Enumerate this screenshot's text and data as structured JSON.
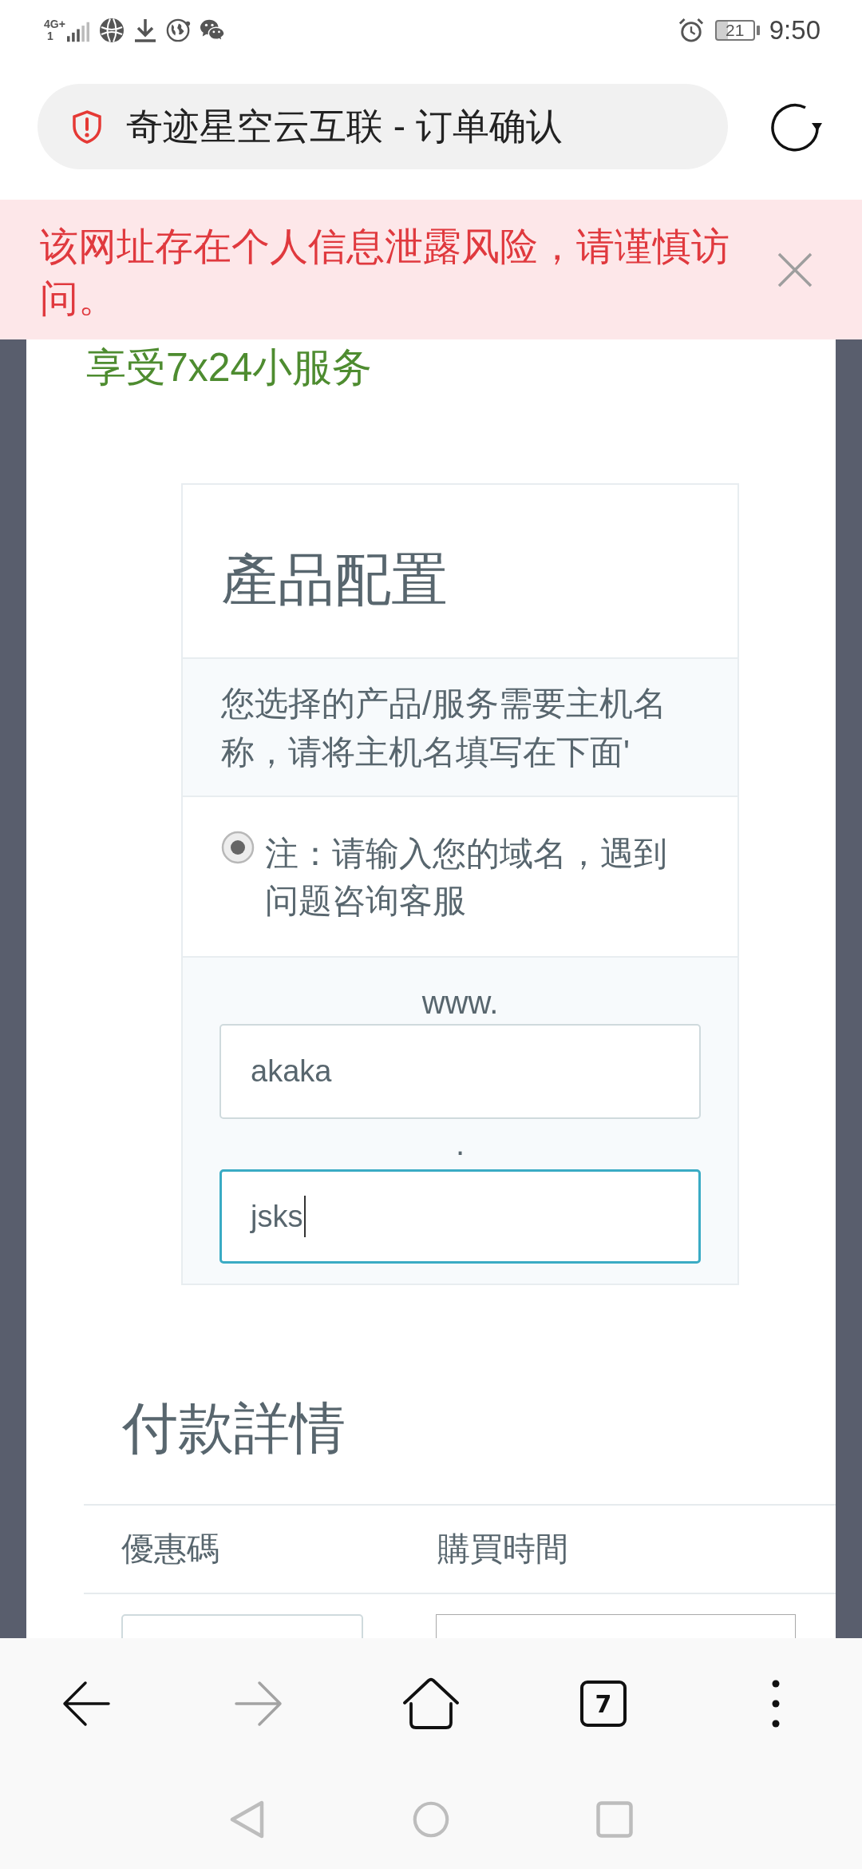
{
  "status_bar": {
    "network": "4G+",
    "sim": "1",
    "battery": "21",
    "time": "9:50"
  },
  "address_bar": {
    "title": "奇迹星空云互联 - 订单确认"
  },
  "warning_banner": {
    "text": "该网址存在个人信息泄露风险，请谨慎访问。"
  },
  "page": {
    "tagline": "享受7x24小服务",
    "product_config": {
      "title": "產品配置",
      "notice": "您选择的产品/服务需要主机名称，请将主机名填写在下面'",
      "option": {
        "label": "注：请输入您的域名，遇到问题咨询客服",
        "selected": true
      },
      "prefix": "www.",
      "hostname": {
        "value": "akaka",
        "focused": false
      },
      "separator": ".",
      "domain": {
        "value": "jsks",
        "focused": true
      }
    },
    "payment": {
      "title": "付款詳情",
      "columns": [
        "優惠碼",
        "購買時間"
      ]
    }
  },
  "toolbar": {
    "forward": {
      "disabled": true
    },
    "tab_count": "7"
  }
}
